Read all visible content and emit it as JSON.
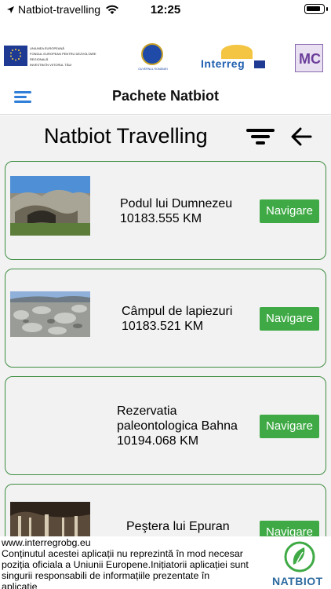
{
  "status_bar": {
    "app_name": "Natbiot-travelling",
    "time": "12:25"
  },
  "logos": {
    "eu_text": [
      "UNIUNEA EUROPEANĂ",
      "FONDUL EUROPEAN PENTRU DEZVOLTARE REGIONALĂ",
      "INVESTIM ÎN VIITORUL TĂU!"
    ],
    "gov_text": "GUVERNUL ROMÂNIEI",
    "interreg": "Interreg",
    "mc": "MC"
  },
  "nav": {
    "title": "Pachete Natbiot"
  },
  "page": {
    "title": "Natbiot Travelling"
  },
  "items": [
    {
      "name_lines": [
        "Podul lui Dumnezeu"
      ],
      "distance": "10183.555 KM",
      "button": "Navigare",
      "has_image": true
    },
    {
      "name_lines": [
        "Câmpul de lapiezuri"
      ],
      "distance": "10183.521 KM",
      "button": "Navigare",
      "has_image": true
    },
    {
      "name_lines": [
        "Rezervatia",
        "paleontologica Bahna"
      ],
      "distance": "10194.068 KM",
      "button": "Navigare",
      "has_image": false
    },
    {
      "name_lines": [
        "Peştera lui Epuran"
      ],
      "distance": "",
      "button": "Navigare",
      "has_image": true
    }
  ],
  "footer": {
    "lines": [
      "www.interregrobg.eu",
      "Conținutul acestei aplicații nu reprezintă în mod necesar",
      "poziția oficiala a Uniunii Europene.Inițiatorii aplicației sunt",
      "singurii responsabili de informațiile prezentate în",
      "aplicatie"
    ],
    "brand": "NATBIOT"
  },
  "colors": {
    "accent_blue": "#2f7ed8",
    "button_green": "#3faa45",
    "card_border": "#3e8e41",
    "content_bg": "#f2f2f2"
  }
}
